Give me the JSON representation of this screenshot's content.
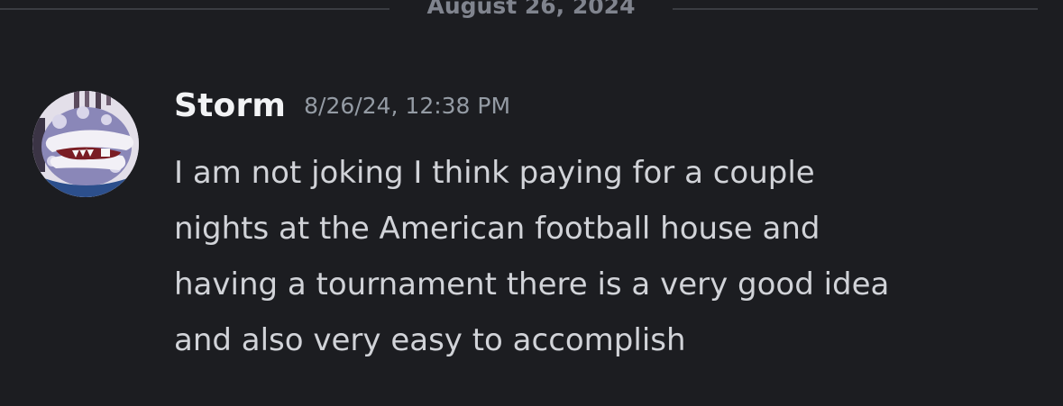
{
  "divider": {
    "date": "August 26, 2024"
  },
  "message": {
    "username": "Storm",
    "timestamp": "8/26/24, 12:38 PM",
    "content": "I am not joking I think paying for a couple\nnights at the American football house and\nhaving a tournament there is a very good idea\nand also very easy to accomplish",
    "avatar_icon": "piranha-plant-avatar"
  },
  "colors": {
    "background": "#1c1d21",
    "username": "#f2f3f5",
    "timestamp": "#949ba4",
    "content": "#d1d3d8",
    "divider_line": "#3a3c42",
    "divider_text": "#80848e"
  }
}
